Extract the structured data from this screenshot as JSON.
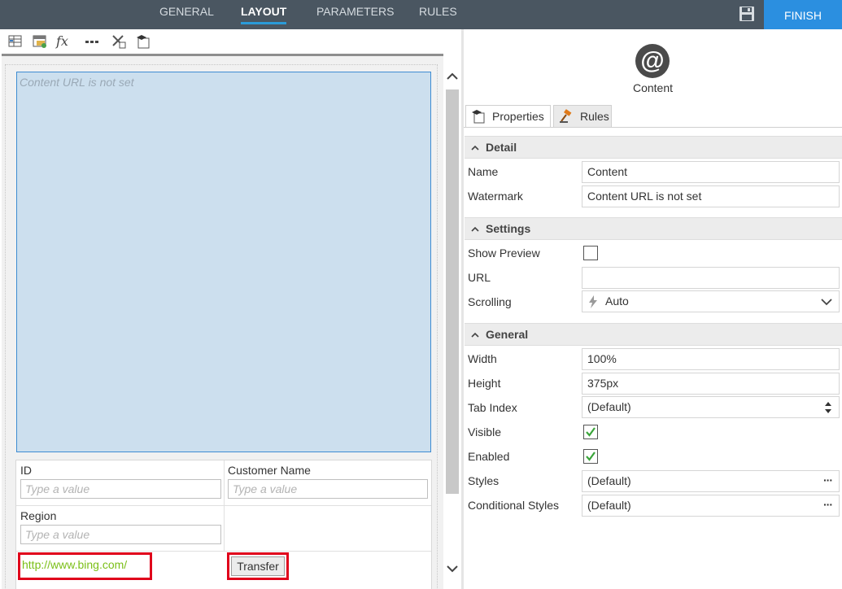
{
  "topnav": {
    "tabs": [
      "GENERAL",
      "LAYOUT",
      "PARAMETERS",
      "RULES"
    ],
    "active_tab": "LAYOUT",
    "finish_label": "FINISH"
  },
  "canvas": {
    "content_watermark": "Content URL is not set",
    "fields": {
      "id_label": "ID",
      "id_placeholder": "Type a value",
      "customer_label": "Customer Name",
      "customer_placeholder": "Type a value",
      "region_label": "Region",
      "region_placeholder": "Type a value"
    },
    "link_text": "http://www.bing.com/",
    "transfer_label": "Transfer"
  },
  "panel": {
    "control_name": "Content",
    "tabs": [
      "Properties",
      "Rules"
    ],
    "sections": {
      "detail": "Detail",
      "settings": "Settings",
      "general": "General"
    },
    "detail": {
      "name_label": "Name",
      "name_value": "Content",
      "watermark_label": "Watermark",
      "watermark_value": "Content URL is not set"
    },
    "settings": {
      "show_preview_label": "Show Preview",
      "show_preview_checked": false,
      "url_label": "URL",
      "url_value": "",
      "scrolling_label": "Scrolling",
      "scrolling_value": "Auto"
    },
    "general": {
      "width_label": "Width",
      "width_value": "100%",
      "height_label": "Height",
      "height_value": "375px",
      "tab_index_label": "Tab Index",
      "tab_index_value": "(Default)",
      "visible_label": "Visible",
      "visible_checked": true,
      "enabled_label": "Enabled",
      "enabled_checked": true,
      "styles_label": "Styles",
      "styles_value": "(Default)",
      "cond_styles_label": "Conditional Styles",
      "cond_styles_value": "(Default)",
      "ellipsis": "···"
    }
  },
  "colors": {
    "topbar": "#4a5661",
    "finish": "#2b8fe0",
    "active_underline": "#2b9bd8",
    "content_bg": "#ccdfee",
    "highlight": "#e0001b",
    "link": "#7bbf18",
    "check": "#3aa53a"
  },
  "icons": [
    "save-icon",
    "table-icon",
    "form-icon",
    "fx-icon",
    "ellipsis-icon",
    "tools-icon",
    "cap-icon",
    "at-icon",
    "properties-icon",
    "rules-gavel-icon",
    "chevron-up-icon",
    "chevron-down-icon",
    "lightning-icon",
    "spinner-icon",
    "check-icon"
  ]
}
